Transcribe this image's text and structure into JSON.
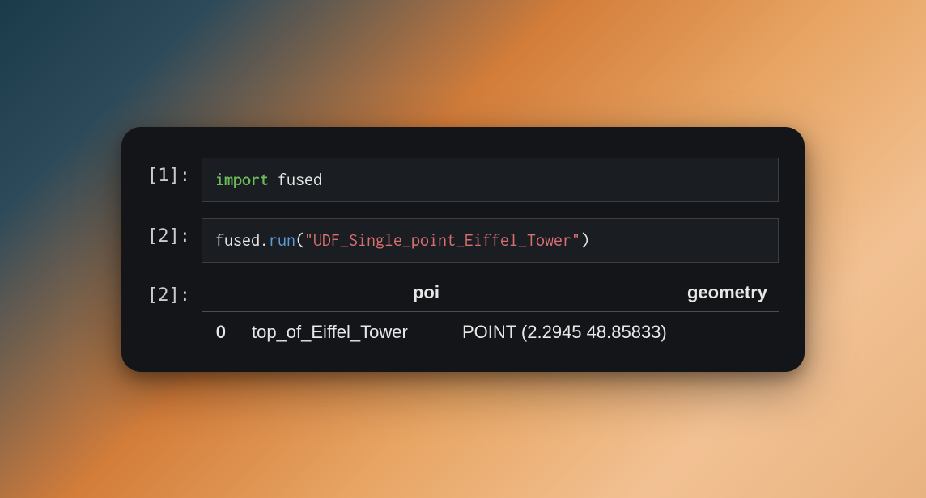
{
  "cells": {
    "cell1": {
      "prompt": "[1]:",
      "code": {
        "keyword": "import",
        "module": "fused"
      }
    },
    "cell2": {
      "prompt": "[2]:",
      "code": {
        "object": "fused",
        "dot": ".",
        "method": "run",
        "open": "(",
        "string": "\"UDF_Single_point_Eiffel_Tower\"",
        "close": ")"
      }
    },
    "output": {
      "prompt": "[2]:",
      "headers": {
        "poi": "poi",
        "geometry": "geometry"
      },
      "row": {
        "index": "0",
        "poi": "top_of_Eiffel_Tower",
        "geometry": "POINT (2.2945 48.85833)"
      }
    }
  }
}
